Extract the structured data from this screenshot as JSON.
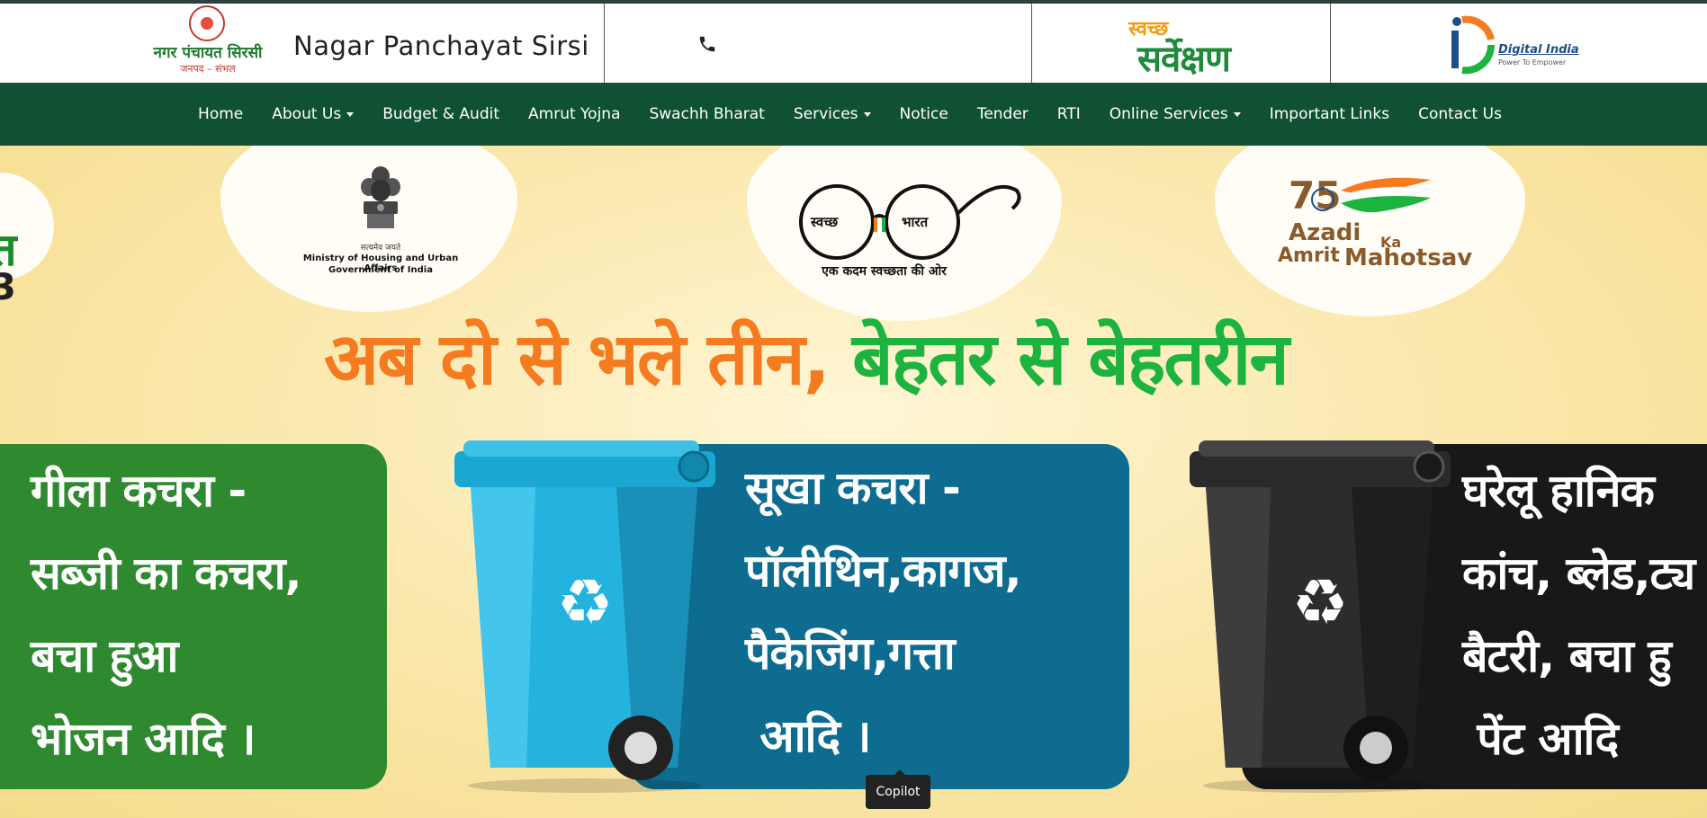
{
  "header": {
    "logo_hindi": "नगर पंचायत सिरसी",
    "logo_sub": "जनपद – संभल",
    "site_title": "Nagar Panchayat Sirsi",
    "phone_icon": "phone-icon",
    "swachh_top": "स्वच्छ",
    "swachh_bottom": "सर्वेक्षण",
    "digital_india": "Digital India",
    "digital_india_sub": "Power To Empower"
  },
  "nav": {
    "items": [
      {
        "label": "Home",
        "dropdown": false
      },
      {
        "label": "About Us",
        "dropdown": true
      },
      {
        "label": "Budget & Audit",
        "dropdown": false
      },
      {
        "label": "Amrut Yojna",
        "dropdown": false
      },
      {
        "label": "Swachh Bharat",
        "dropdown": false
      },
      {
        "label": "Services",
        "dropdown": true
      },
      {
        "label": "Notice",
        "dropdown": false
      },
      {
        "label": "Tender",
        "dropdown": false
      },
      {
        "label": "RTI",
        "dropdown": false
      },
      {
        "label": "Online Services",
        "dropdown": true
      },
      {
        "label": "Important Links",
        "dropdown": false
      },
      {
        "label": "Contact Us",
        "dropdown": false
      }
    ]
  },
  "banner": {
    "edge_letter": "त",
    "edge_digit": "3",
    "moh_motto": "सत्यमेव जयते",
    "moh_line1": "Ministry of Housing and Urban Affairs",
    "moh_line2": "Government of India",
    "sb_left": "स्वच्छ",
    "sb_right": "भारत",
    "sb_tag": "एक कदम स्वच्छता की ओर",
    "azadi_1": "Azadi",
    "azadi_2": "Ka",
    "azadi_3": "Amrit",
    "azadi_4": "Mahotsav",
    "azadi_75": "75",
    "slogan_a": "अब दो से भले तीन, ",
    "slogan_b": "बेहतर से बेहतरीन",
    "panel_green": "गीला कचरा -\nसब्जी का कचरा,\nबचा हुआ\nभोजन आदि ।",
    "panel_blue": "सूखा कचरा -\nपॉलीथिन,कागज,\nपैकेजिंग,गत्ता\n आदि ।",
    "panel_black": "घरेलू हानिक\nकांच, ब्लेड,ट्य\nबैटरी, बचा हु\n पेंट आदि"
  },
  "colors": {
    "nav_bg": "#0f5132",
    "slogan_orange": "#f47b20",
    "slogan_green": "#1db33f",
    "panel_green": "#2f8a2f",
    "panel_blue": "#0d6c8f",
    "panel_black": "#181818"
  },
  "tooltip": {
    "label": "Copilot"
  }
}
